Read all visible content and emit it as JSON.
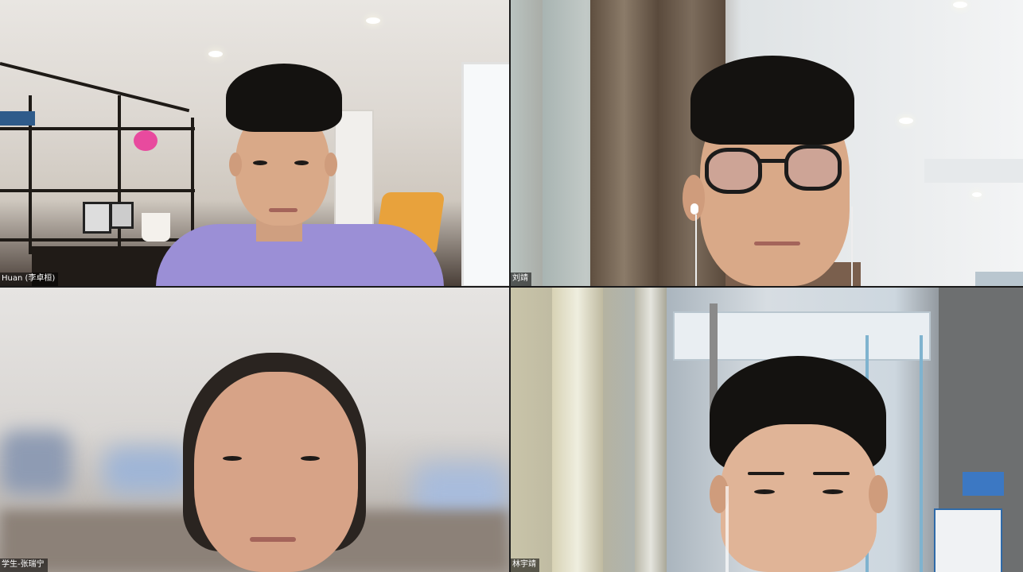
{
  "meeting": {
    "participants": [
      {
        "name_label": "Huan (李卓桓)"
      },
      {
        "name_label": "刘靖"
      },
      {
        "name_label": "学生-张瑞宁"
      },
      {
        "name_label": "林宇靖"
      }
    ]
  }
}
